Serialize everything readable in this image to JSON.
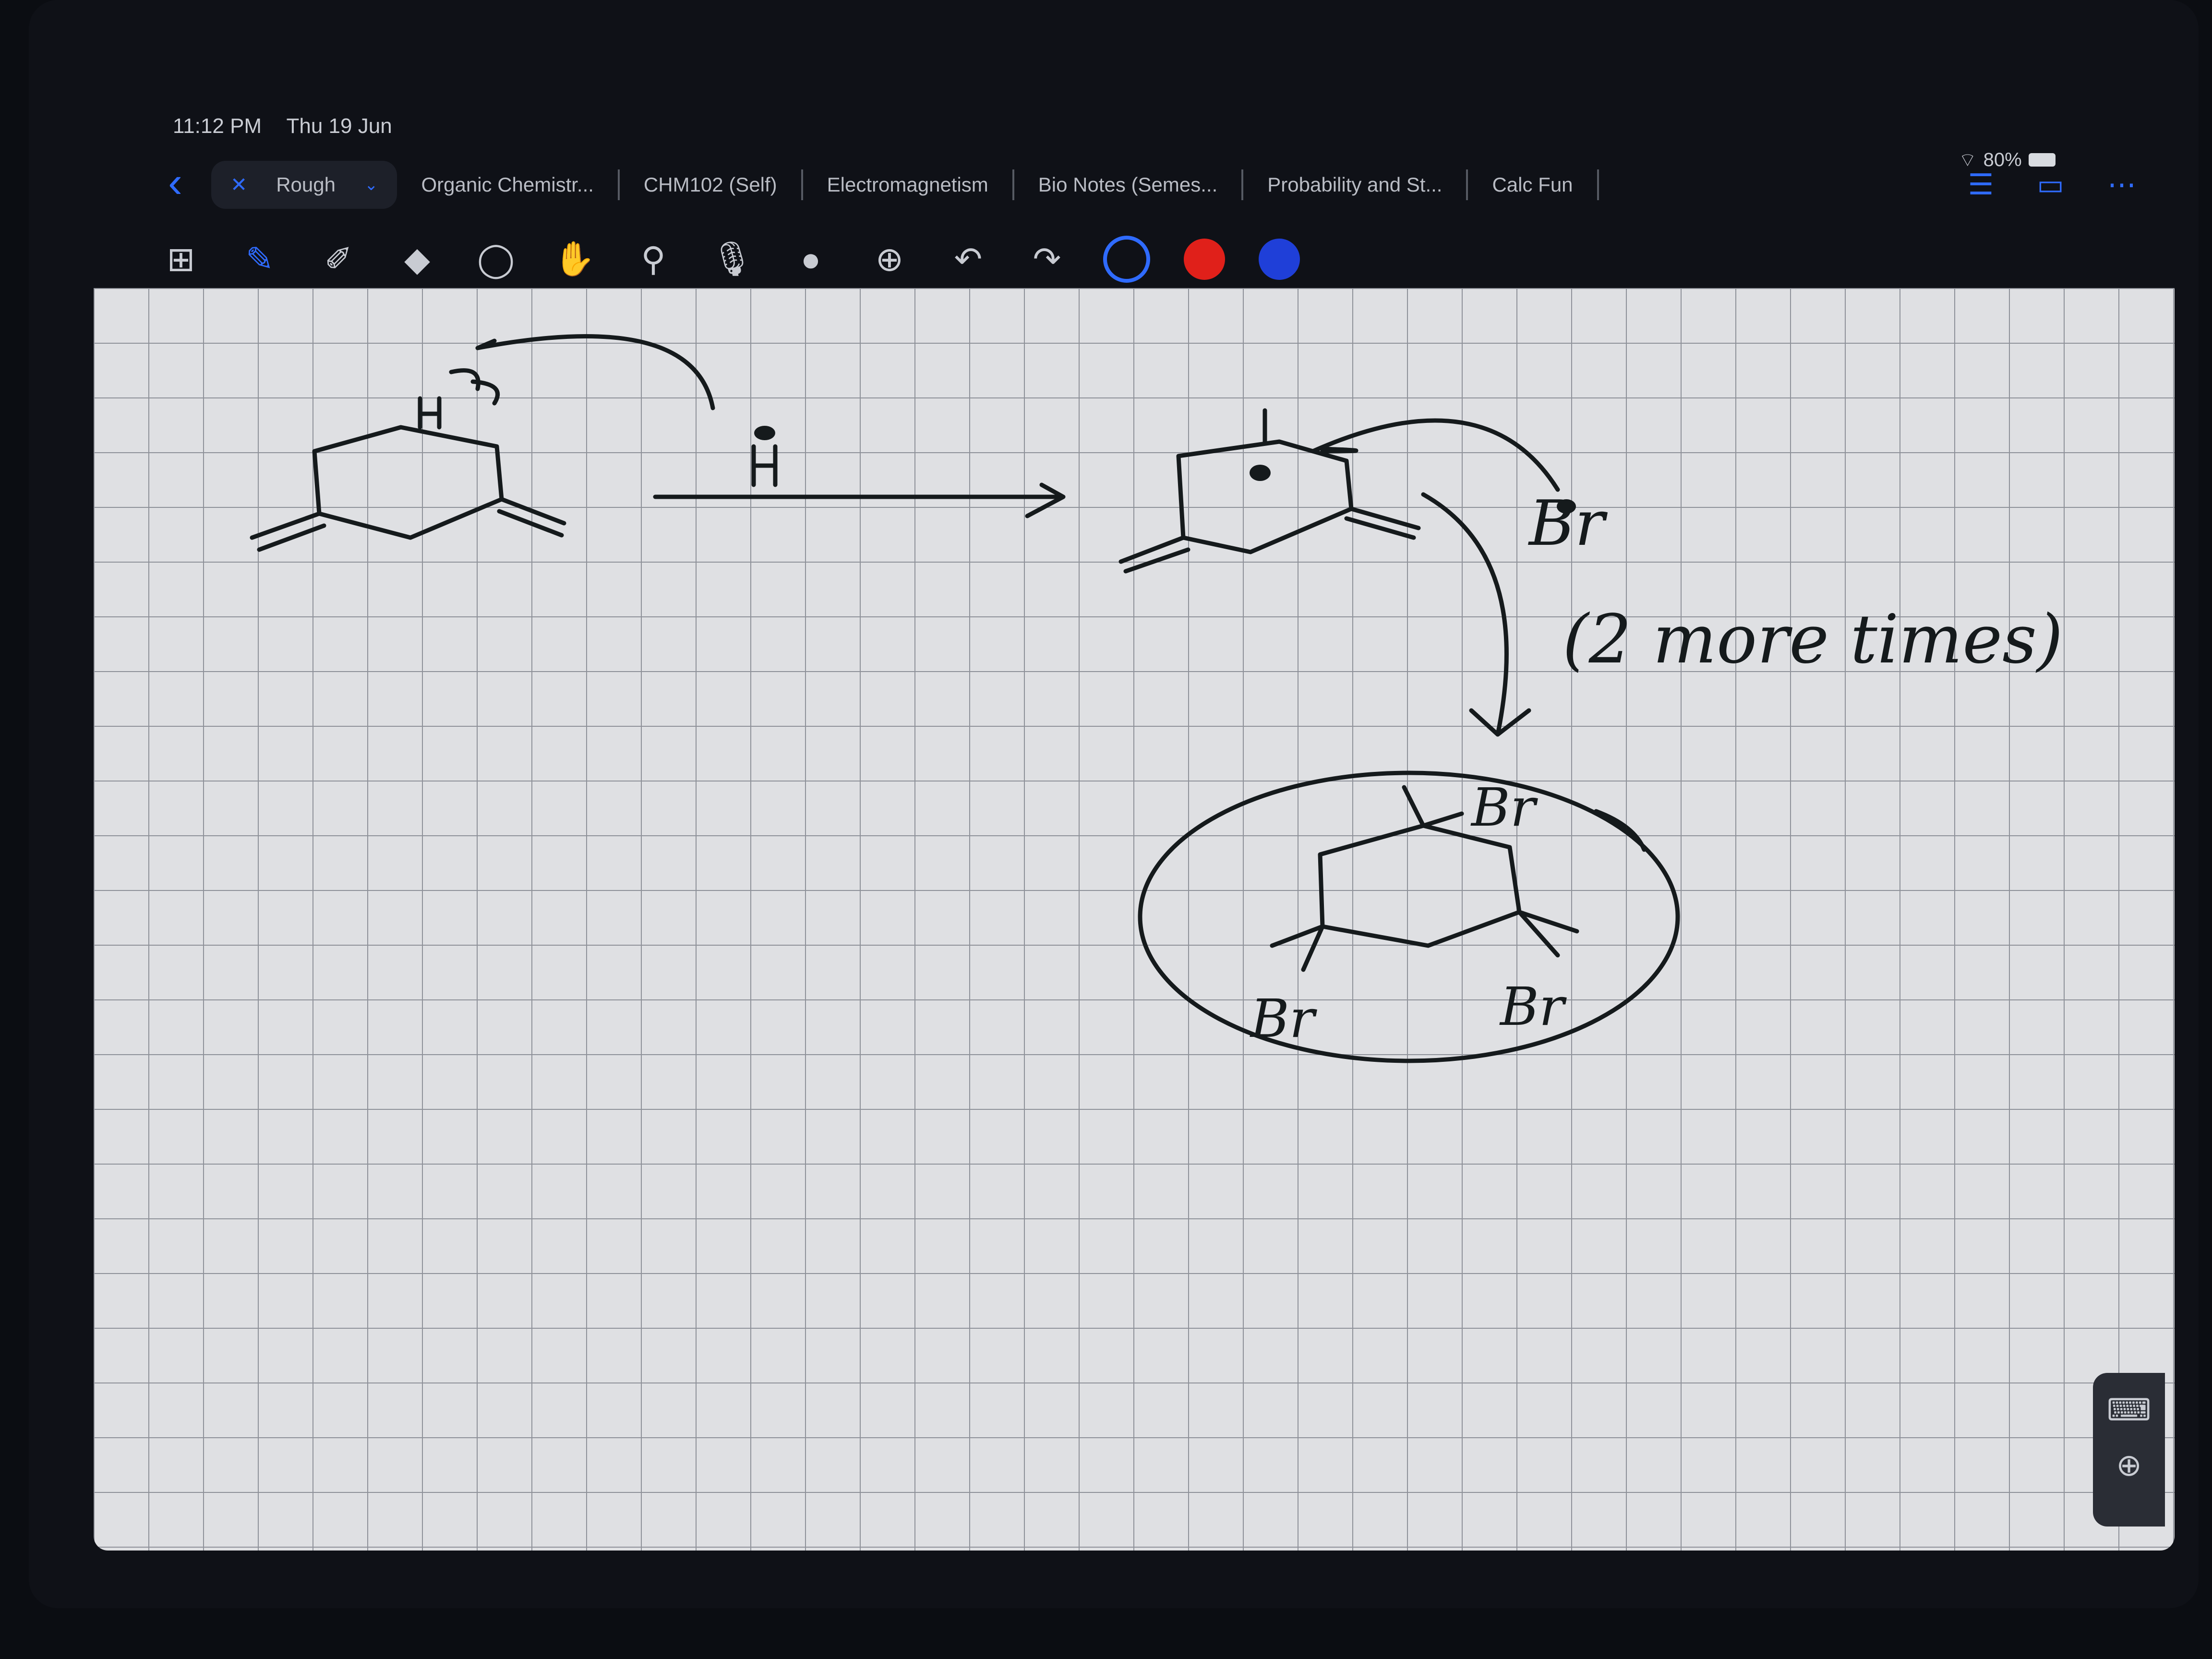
{
  "status": {
    "time": "11:12 PM",
    "date": "Thu 19 Jun",
    "battery": "80%"
  },
  "tabs": [
    {
      "label": "Rough",
      "active": true
    },
    {
      "label": "Organic Chemistr..."
    },
    {
      "label": "CHM102 (Self)"
    },
    {
      "label": "Electromagnetism"
    },
    {
      "label": "Bio Notes (Semes..."
    },
    {
      "label": "Probability and St..."
    },
    {
      "label": "Calc Fun"
    }
  ],
  "toolbar": {
    "tools": [
      "grid-icon",
      "pen-icon",
      "highlighter-icon",
      "eraser-icon",
      "lasso-icon",
      "hand-icon",
      "pipette-icon",
      "mic-icon",
      "shape-icon",
      "add-icon",
      "undo-icon",
      "redo-icon"
    ],
    "colors": {
      "selected": "#2f6bff",
      "red": "#e0201a",
      "blue": "#1f3fd8"
    }
  },
  "canvas": {
    "handwriting": {
      "reagent": "H",
      "bromine_label": "Br",
      "repeat_note": "(2 more times)",
      "product_labels": [
        "Br",
        "Br",
        "Br"
      ],
      "h_label": "H"
    }
  }
}
